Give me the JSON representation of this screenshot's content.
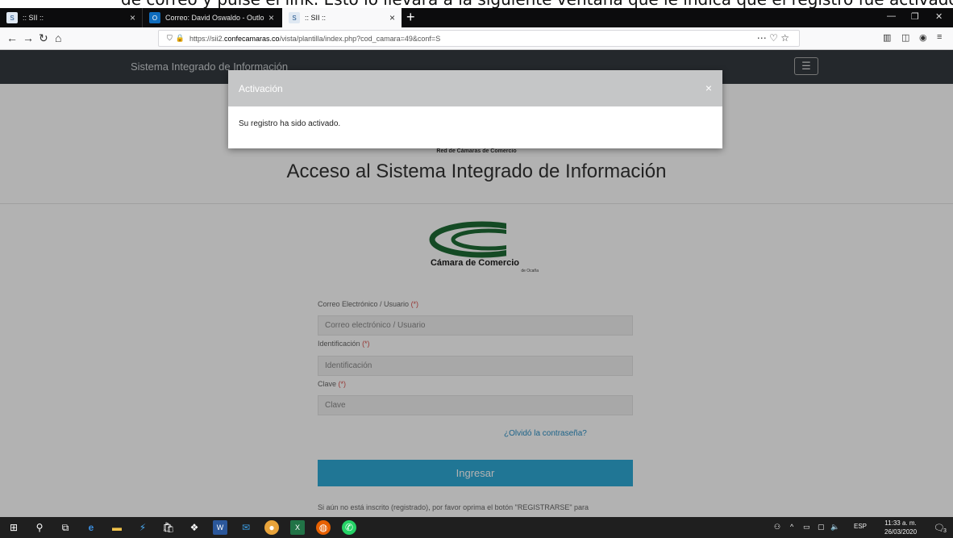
{
  "caption_fragment": "de correo y pulse el link. Esto lo llevará a la siguiente ventana que le indica que el registro fue activado",
  "browser": {
    "tabs": [
      {
        "label": ":: SII ::",
        "favicon": "sii-favicon"
      },
      {
        "label": "Correo: David Oswaldo - Outlo",
        "favicon": "outlook-favicon"
      },
      {
        "label": ":: SII ::",
        "favicon": "sii-favicon",
        "active": true
      }
    ],
    "url_prefix": "https://sii2.",
    "url_host": "confecamaras.co",
    "url_path": "/vista/plantilla/index.php?cod_camara=49&conf=S"
  },
  "site": {
    "brand": "Sistema Integrado de Información",
    "network_label": "Red de Cámaras de Comercio",
    "title": "Acceso al Sistema Integrado de Información",
    "logo_name": "Cámara de Comercio",
    "logo_city": "de Ocaña"
  },
  "form": {
    "email_label": "Correo Electrónico / Usuario",
    "email_placeholder": "Correo electrónico / Usuario",
    "id_label": "Identificación",
    "id_placeholder": "Identificación",
    "password_label": "Clave",
    "password_placeholder": "Clave",
    "required_mark": "(*)",
    "forgot_link": "¿Olvidó la contraseña?",
    "submit_label": "Ingresar",
    "register_hint": "Si aún no está inscrito (registrado), por favor oprima el botón \"REGISTRARSE\" para"
  },
  "modal": {
    "title": "Activación",
    "close": "×",
    "message": "Su registro ha sido activado."
  },
  "taskbar": {
    "language": "ESP",
    "time": "11:33 a. m.",
    "date": "26/03/2020",
    "notifications": "3"
  },
  "colors": {
    "site_nav": "#343a40",
    "submit_button": "#2eaad6",
    "modal_header": "#c5c6c7",
    "required": "#d9534f"
  }
}
